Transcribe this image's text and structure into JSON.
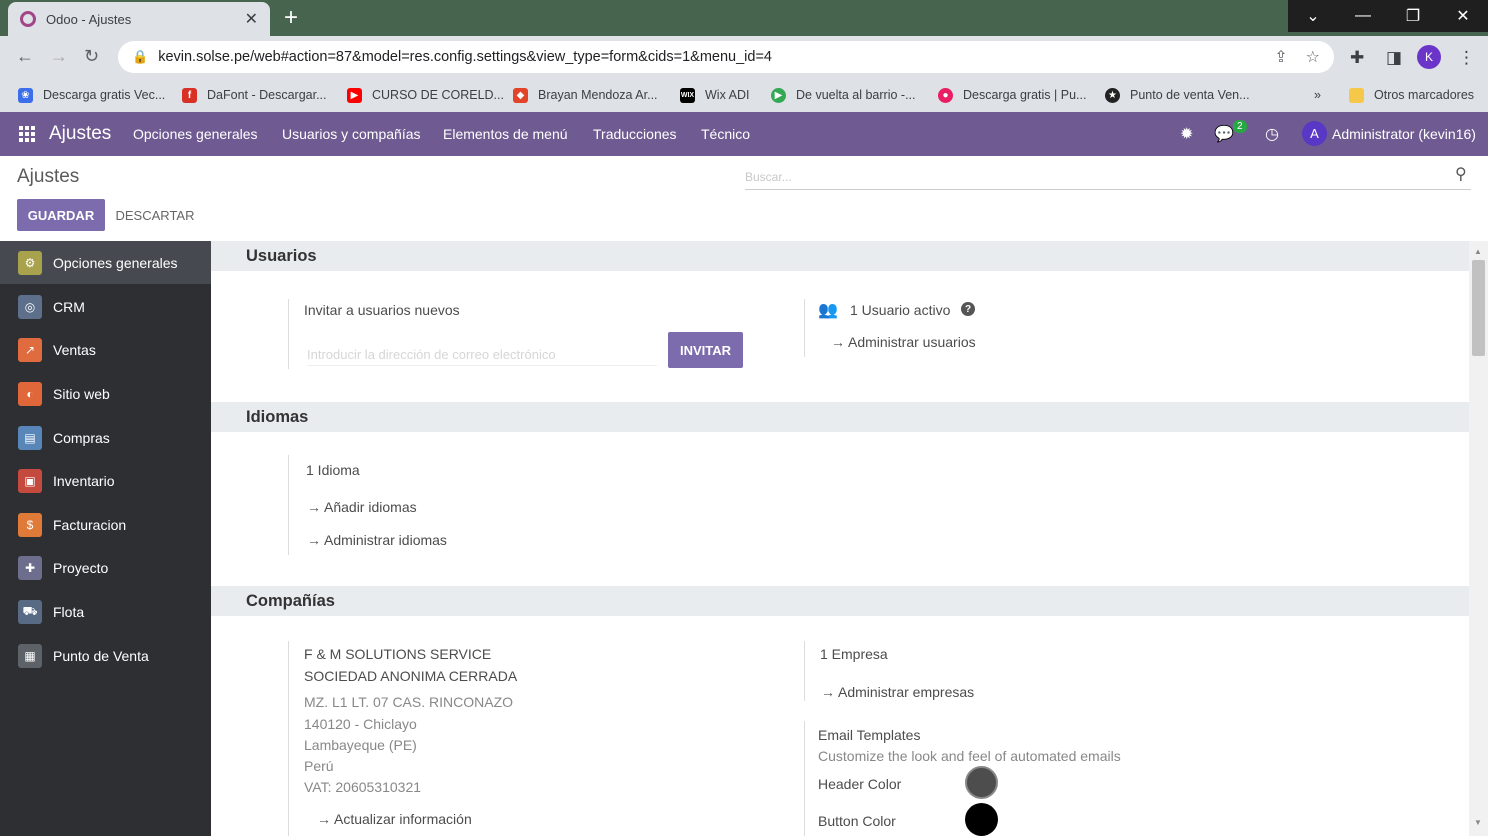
{
  "browser": {
    "tab_title": "Odoo - Ajustes",
    "url": "kevin.solse.pe/web#action=87&model=res.config.settings&view_type=form&cids=1&menu_id=4",
    "profile_initial": "K",
    "bookmarks": [
      {
        "label": "Descarga gratis Vec...",
        "color": "#3b6ee8"
      },
      {
        "label": "DaFont - Descargar...",
        "color": "#d93025"
      },
      {
        "label": "CURSO DE CORELD...",
        "color": "#ff0000"
      },
      {
        "label": "Brayan Mendoza Ar...",
        "color": "#e24329"
      },
      {
        "label": "Wix ADI",
        "color": "#000000"
      },
      {
        "label": "De vuelta al barrio -...",
        "color": "#34a853"
      },
      {
        "label": "Descarga gratis | Pu...",
        "color": "#e91e63"
      },
      {
        "label": "Punto de venta Ven...",
        "color": "#222222"
      }
    ],
    "more_bookmarks": "»",
    "other_bookmarks": "Otros marcadores"
  },
  "navbar": {
    "brand": "Ajustes",
    "menu": [
      "Opciones generales",
      "Usuarios y compañías",
      "Elementos de menú",
      "Traducciones",
      "Técnico"
    ],
    "messages_count": "2",
    "user_initial": "A",
    "user_name": "Administrator (kevin16)"
  },
  "control_panel": {
    "breadcrumb": "Ajustes",
    "search_placeholder": "Buscar...",
    "save_label": "GUARDAR",
    "discard_label": "DESCARTAR"
  },
  "sidebar": {
    "items": [
      {
        "label": "Opciones generales",
        "color": "#a9a24c",
        "icon": "⚙"
      },
      {
        "label": "CRM",
        "color": "#5d6f8b",
        "icon": "◎"
      },
      {
        "label": "Ventas",
        "color": "#e06b3e",
        "icon": "↗"
      },
      {
        "label": "Sitio web",
        "color": "#e0673a",
        "icon": "◐"
      },
      {
        "label": "Compras",
        "color": "#5886b8",
        "icon": "▤"
      },
      {
        "label": "Inventario",
        "color": "#c44a3f",
        "icon": "▣"
      },
      {
        "label": "Facturacion",
        "color": "#e07a39",
        "icon": "$"
      },
      {
        "label": "Proyecto",
        "color": "#6d6e8e",
        "icon": "✚"
      },
      {
        "label": "Flota",
        "color": "#596a84",
        "icon": "⛟"
      },
      {
        "label": "Punto de Venta",
        "color": "#5d6268",
        "icon": "▦"
      }
    ]
  },
  "sections": {
    "usuarios": {
      "title": "Usuarios",
      "invite_label": "Invitar a usuarios nuevos",
      "invite_placeholder": "Introducir la dirección de correo electrónico",
      "invite_button": "INVITAR",
      "active_users": "1 Usuario activo",
      "manage_users": "Administrar usuarios"
    },
    "idiomas": {
      "title": "Idiomas",
      "count": "1 Idioma",
      "add_languages": "Añadir idiomas",
      "manage_languages": "Administrar idiomas"
    },
    "companias": {
      "title": "Compañías",
      "company_name_1": "F & M SOLUTIONS SERVICE",
      "company_name_2": "SOCIEDAD ANONIMA CERRADA",
      "address_1": "MZ. L1 LT. 07 CAS. RINCONAZO",
      "address_2": "140120 - Chiclayo",
      "address_3": "Lambayeque (PE)",
      "address_4": "Perú",
      "vat": "VAT: 20605310321",
      "update_info": "Actualizar información",
      "companies_count": "1 Empresa",
      "manage_companies": "Administrar empresas",
      "email_templates_title": "Email Templates",
      "email_templates_desc": "Customize the look and feel of automated emails",
      "header_color_label": "Header Color",
      "header_color": "#4d4d4d",
      "button_color_label": "Button Color",
      "button_color": "#000000"
    }
  }
}
